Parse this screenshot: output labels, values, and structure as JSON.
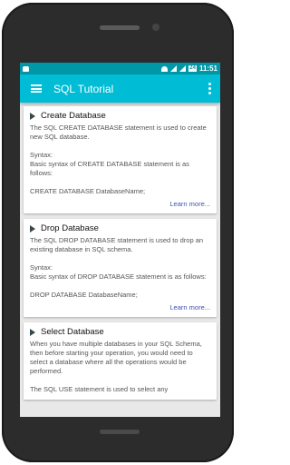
{
  "status": {
    "time": "11:51",
    "battery": "24"
  },
  "toolbar": {
    "title": "SQL Tutorial"
  },
  "cards": [
    {
      "title": "Create Database",
      "desc": "The SQL CREATE DATABASE statement is used to create new SQL database.",
      "syntax": "Syntax:\nBasic syntax of CREATE DATABASE statement is as follows:",
      "example": "CREATE DATABASE DatabaseName;",
      "link": "Learn more..."
    },
    {
      "title": "Drop Database",
      "desc": "The SQL DROP DATABASE statement is used to drop an existing database in SQL schema.",
      "syntax": "Syntax:\nBasic syntax of DROP DATABASE statement is as follows:",
      "example": "DROP DATABASE DatabaseName;",
      "link": "Learn more..."
    },
    {
      "title": "Select Database",
      "desc": "When you have multiple databases in your SQL Schema, then before starting your operation, you would need to select a database where all the operations would be performed.",
      "syntax": "The SQL USE statement is used to select any"
    }
  ]
}
